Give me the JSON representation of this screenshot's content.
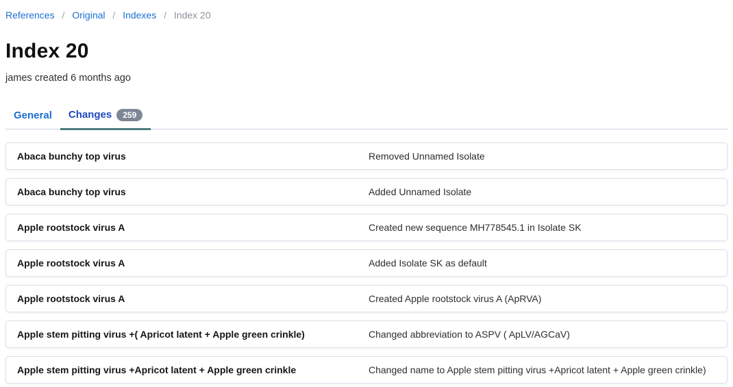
{
  "breadcrumb": {
    "separator": "/",
    "items": [
      {
        "label": "References"
      },
      {
        "label": "Original"
      },
      {
        "label": "Indexes"
      },
      {
        "label": "Index 20"
      }
    ]
  },
  "header": {
    "title": "Index 20",
    "attribution": "james created 6 months ago"
  },
  "tabs": [
    {
      "label": "General",
      "active": false
    },
    {
      "label": "Changes",
      "active": true,
      "badge": "259"
    }
  ],
  "changes": [
    {
      "name": "Abaca bunchy top virus",
      "description": "Removed Unnamed Isolate"
    },
    {
      "name": "Abaca bunchy top virus",
      "description": "Added Unnamed Isolate"
    },
    {
      "name": "Apple rootstock virus A",
      "description": "Created new sequence MH778545.1 in Isolate SK"
    },
    {
      "name": "Apple rootstock virus A",
      "description": "Added Isolate SK as default"
    },
    {
      "name": "Apple rootstock virus A",
      "description": "Created Apple rootstock virus A (ApRVA)"
    },
    {
      "name": "Apple stem pitting virus +( Apricot latent + Apple green crinkle)",
      "description": "Changed abbreviation to ASPV ( ApLV/AGCaV)"
    },
    {
      "name": "Apple stem pitting virus +Apricot latent + Apple green crinkle",
      "description": "Changed name to Apple stem pitting virus +Apricot latent + Apple green crinkle)"
    }
  ],
  "colors": {
    "link_blue": "#1d6fd2",
    "active_tab_blue": "#2149c0",
    "active_tab_underline_teal": "#4b7c7e",
    "badge_gray": "#7d8796",
    "breadcrumb_muted": "#8c9199",
    "card_border": "#dce1ea",
    "tab_divider": "#ccd6e3"
  }
}
